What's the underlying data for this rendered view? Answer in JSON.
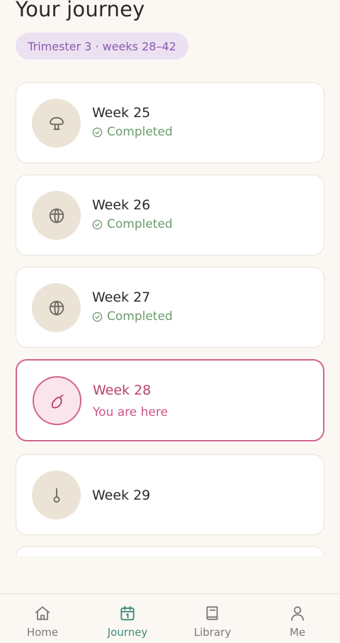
{
  "header": {
    "title": "Your journey",
    "trimester": "Trimester 3 · weeks 28–42"
  },
  "weeks": [
    {
      "label": "Week 25",
      "status": "Completed",
      "icon": "mushroom-icon",
      "state": "completed"
    },
    {
      "label": "Week 26",
      "status": "Completed",
      "icon": "globe-fruit-icon",
      "state": "completed"
    },
    {
      "label": "Week 27",
      "status": "Completed",
      "icon": "globe-fruit-icon",
      "state": "completed"
    },
    {
      "label": "Week 28",
      "status": "You are here",
      "icon": "eggplant-icon",
      "state": "current"
    },
    {
      "label": "Week 29",
      "status": "",
      "icon": "squash-icon",
      "state": "upcoming"
    }
  ],
  "nav": {
    "items": [
      {
        "label": "Home",
        "icon": "home-icon"
      },
      {
        "label": "Journey",
        "icon": "calendar-icon",
        "active": true
      },
      {
        "label": "Library",
        "icon": "book-icon"
      },
      {
        "label": "Me",
        "icon": "person-icon"
      }
    ]
  },
  "colors": {
    "background": "#fbf8f3",
    "accent_pink": "#d1638d",
    "completed_green": "#6b9b6b",
    "nav_active": "#3f8a7a",
    "pill_bg": "#ebe1f1",
    "pill_text": "#8a5bb0"
  }
}
